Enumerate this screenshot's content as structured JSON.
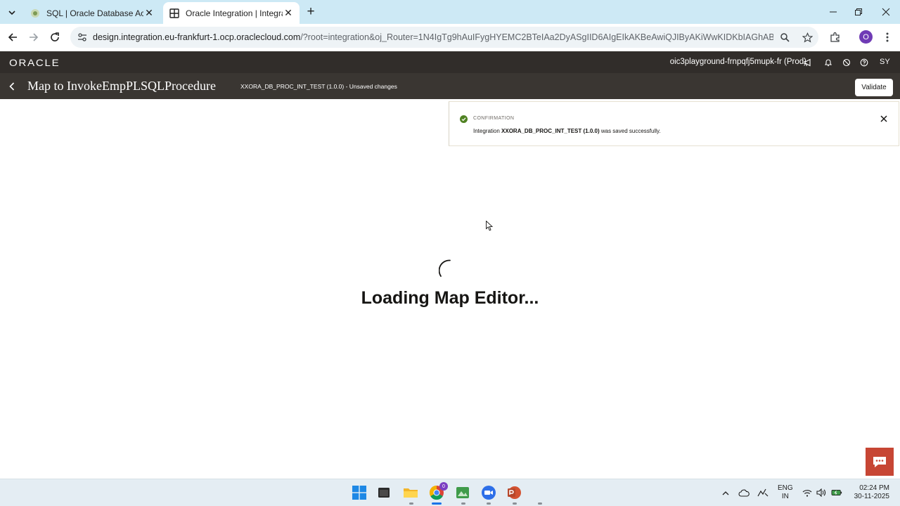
{
  "browser": {
    "tabs": [
      {
        "title": "SQL | Oracle Database Actions",
        "active": false
      },
      {
        "title": "Oracle Integration | Integration",
        "active": true
      }
    ],
    "url_host": "design.integration.eu-frankfurt-1.ocp.oraclecloud.com",
    "url_path": "/?root=integration&oj_Router=1N4IgTg9hAuIFygHYEMC2BTeIAa2DyASgIID6AIgEIkAKBeAwiQJIByAKiWwKIDKbIAGhABjCABNMcHPm..."
  },
  "oic_header": {
    "brand": "ORACLE",
    "environment": "oic3playground-frnpqfj5mupk-fr (Prod)",
    "user_initials": "SY"
  },
  "page_header": {
    "title": "Map to InvokeEmpPLSQLProcedure",
    "integration_status": "XXORA_DB_PROC_INT_TEST (1.0.0) - Unsaved changes",
    "validate_label": "Validate"
  },
  "toast": {
    "heading": "CONFIRMATION",
    "message_prefix": "Integration ",
    "message_name": "XXORA_DB_PROC_INT_TEST (1.0.0)",
    "message_suffix": " was saved successfully."
  },
  "loading": {
    "text": "Loading Map Editor..."
  },
  "taskbar": {
    "chrome_badge": "0",
    "language": [
      "ENG",
      "IN"
    ],
    "time": "02:24 PM",
    "date": "30-11-2025"
  },
  "colors": {
    "tabstrip": "#cde9f5",
    "oracle_header": "#312d2a",
    "page_header": "#3a3632",
    "success": "#508223",
    "chat": "#c74634"
  }
}
